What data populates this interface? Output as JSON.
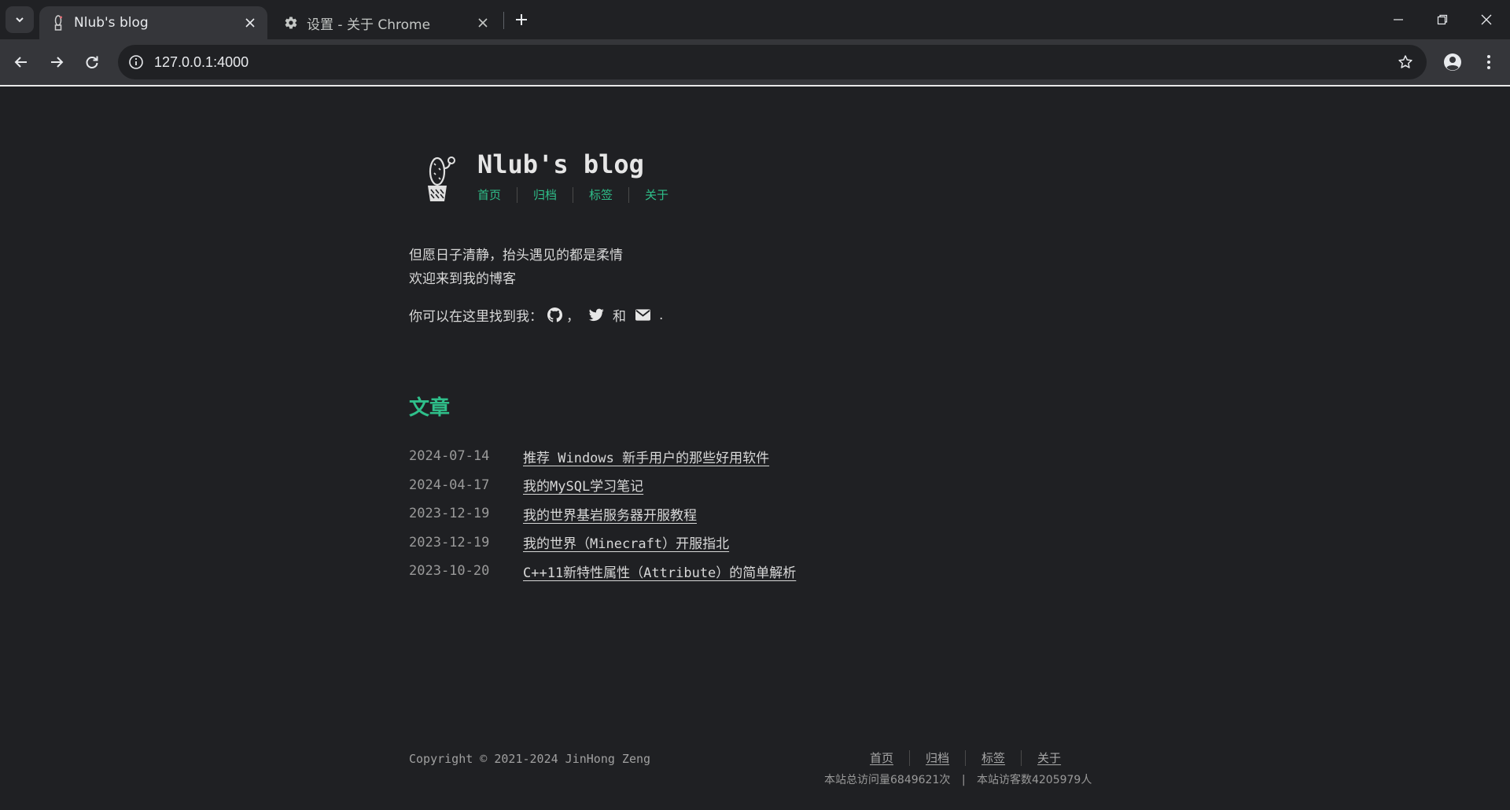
{
  "browser": {
    "tabs": [
      {
        "title": "Nlub's blog",
        "active": true
      },
      {
        "title": "设置 - 关于 Chrome",
        "active": false
      }
    ],
    "url": "127.0.0.1:4000",
    "colors": {
      "tabstrip": "#202124",
      "toolbar": "#35363a",
      "omnibox": "#202124"
    }
  },
  "header": {
    "site_title": "Nlub's blog",
    "nav": [
      "首页",
      "归档",
      "标签",
      "关于"
    ]
  },
  "intro": {
    "line1": "但愿日子清静，抬头遇见的都是柔情",
    "line2": "欢迎来到我的博客",
    "find_me_prefix": "你可以在这里找到我：",
    "find_me_comma": "，",
    "find_me_and": "和",
    "find_me_period": ".",
    "icons": [
      "github-icon",
      "twitter-icon",
      "email-icon"
    ]
  },
  "posts_section": {
    "title": "文章",
    "items": [
      {
        "date": "2024-07-14",
        "title": "推荐 Windows 新手用户的那些好用软件"
      },
      {
        "date": "2024-04-17",
        "title": "我的MySQL学习笔记"
      },
      {
        "date": "2023-12-19",
        "title": "我的世界基岩服务器开服教程"
      },
      {
        "date": "2023-12-19",
        "title": "我的世界（Minecraft）开服指北"
      },
      {
        "date": "2023-10-20",
        "title": "C++11新特性属性（Attribute）的简单解析"
      }
    ]
  },
  "footer": {
    "copyright": "Copyright © 2021-2024 JinHong Zeng",
    "nav": [
      "首页",
      "归档",
      "标签",
      "关于"
    ],
    "total_visits": "本站总访问量6849621次",
    "divider": "|",
    "visitors": "本站访客数4205979人"
  },
  "theme": {
    "accent": "#2fbf8a",
    "background": "#1f2023",
    "text": "#d8d8d8"
  }
}
